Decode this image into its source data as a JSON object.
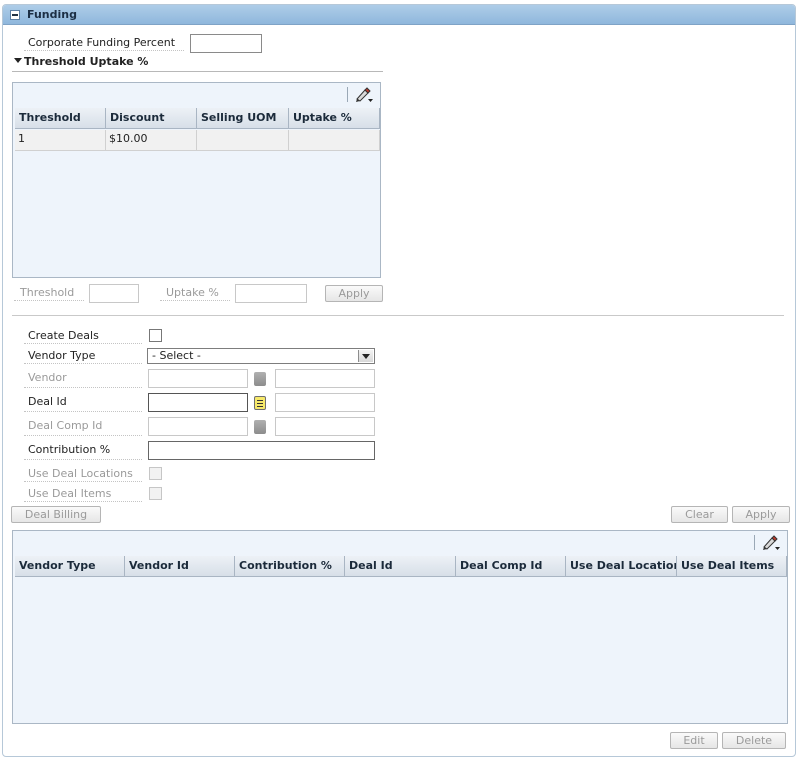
{
  "header": {
    "title": "Funding"
  },
  "corporate_funding": {
    "label": "Corporate Funding Percent",
    "value": ""
  },
  "threshold_section": {
    "title": "Threshold Uptake %",
    "columns": [
      "Threshold",
      "Discount",
      "Selling UOM",
      "Uptake %"
    ],
    "rows": [
      {
        "threshold": "1",
        "discount": "$10.00",
        "selling_uom": "",
        "uptake": ""
      }
    ],
    "threshold_label": "Threshold",
    "threshold_value": "",
    "uptake_label": "Uptake %",
    "uptake_value": "",
    "apply_label": "Apply"
  },
  "form": {
    "create_deals_label": "Create Deals",
    "vendor_type_label": "Vendor Type",
    "vendor_type_value": "- Select -",
    "vendor_label": "Vendor",
    "deal_id_label": "Deal Id",
    "deal_comp_id_label": "Deal Comp Id",
    "contribution_label": "Contribution %",
    "use_deal_locations_label": "Use Deal Locations",
    "use_deal_items_label": "Use Deal Items",
    "deal_billing_label": "Deal Billing",
    "clear_label": "Clear",
    "apply_label": "Apply"
  },
  "vendor_grid": {
    "columns": [
      "Vendor Type",
      "Vendor Id",
      "Contribution %",
      "Deal Id",
      "Deal Comp Id",
      "Use Deal Locations",
      "Use Deal Items"
    ],
    "edit_label": "Edit",
    "delete_label": "Delete"
  },
  "icons": {
    "collapse": "minus-box-icon",
    "expand": "triangle-down-icon",
    "grid_edit": "pencil-icon",
    "lov": "list-of-values-icon"
  },
  "colors": {
    "header_bg": "#9cc2e3",
    "grid_bg": "#eef4fb",
    "disabled_text": "#9a9a9a"
  }
}
